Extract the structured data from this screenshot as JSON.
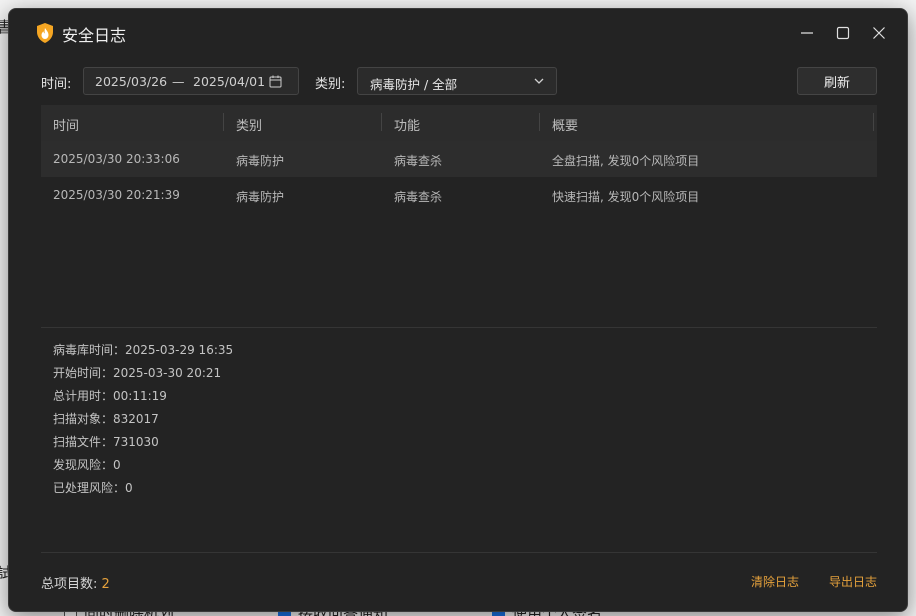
{
  "window": {
    "title": "安全日志",
    "colors": {
      "background": "#232323",
      "accent": "#e6a23c",
      "icon": "#f5a623"
    }
  },
  "filter": {
    "time_label": "时间:",
    "date_from": "2025/03/26",
    "date_separator": "—",
    "date_to": "2025/04/01",
    "category_label": "类别:",
    "category_value": "病毒防护 / 全部",
    "refresh_label": "刷新"
  },
  "table": {
    "columns": [
      "时间",
      "类别",
      "功能",
      "概要"
    ],
    "rows": [
      [
        "2025/03/30 20:33:06",
        "病毒防护",
        "病毒查杀",
        "全盘扫描, 发现0个风险项目"
      ],
      [
        "2025/03/30 20:21:39",
        "病毒防护",
        "病毒查杀",
        "快速扫描, 发现0个风险项目"
      ]
    ]
  },
  "details": [
    "病毒库时间：2025-03-29 16:35",
    "开始时间：2025-03-30 20:21",
    "总计用时：00:11:19",
    "扫描对象：832017",
    "扫描文件：731030",
    "发现风险：0",
    "已处理风险：0"
  ],
  "footer": {
    "total_label": "总项目数:",
    "total_count": "2",
    "clear_label": "清除日志",
    "export_label": "导出日志"
  },
  "background": {
    "frag1": "書",
    "frag2": "試",
    "opt1": "同时删除机划",
    "opt2": "接收问答通知",
    "opt3": "使用个人签名"
  }
}
